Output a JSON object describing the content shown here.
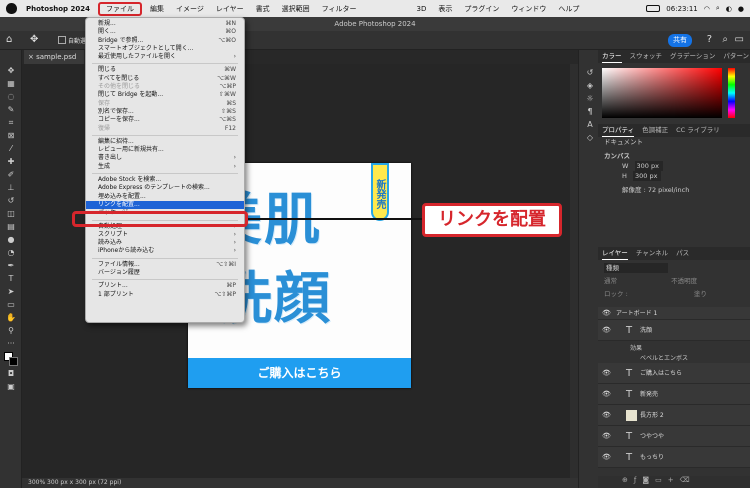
{
  "menubar": {
    "app_name": "Photoshop 2024",
    "items": [
      "ファイル",
      "編集",
      "イメージ",
      "レイヤー",
      "書式",
      "選択範囲",
      "フィルター",
      "3D",
      "表示",
      "プラグイン",
      "ウィンドウ",
      "ヘルプ"
    ],
    "clock": "06:23:11"
  },
  "window_title": "Adobe Photoshop 2024",
  "options": {
    "share_label": "共有",
    "auto_select": "自動選"
  },
  "document_tab": "sample.psd @ 3",
  "file_menu": {
    "g1": [
      {
        "label": "新規...",
        "shortcut": "⌘N"
      },
      {
        "label": "開く...",
        "shortcut": "⌘O"
      },
      {
        "label": "Bridge で参照...",
        "shortcut": "⌥⌘O"
      },
      {
        "label": "スマートオブジェクトとして開く...",
        "shortcut": ""
      },
      {
        "label": "最近使用したファイルを開く",
        "shortcut": "›"
      }
    ],
    "g2": [
      {
        "label": "閉じる",
        "shortcut": "⌘W"
      },
      {
        "label": "すべてを閉じる",
        "shortcut": "⌥⌘W"
      },
      {
        "label": "その他を閉じる",
        "shortcut": "⌥⌘P",
        "disabled": true
      },
      {
        "label": "閉じて Bridge を起動...",
        "shortcut": "⇧⌘W"
      },
      {
        "label": "保存",
        "shortcut": "⌘S",
        "disabled": true
      },
      {
        "label": "別名で保存...",
        "shortcut": "⇧⌘S"
      },
      {
        "label": "コピーを保存...",
        "shortcut": "⌥⌘S"
      },
      {
        "label": "復帰",
        "shortcut": "F12",
        "disabled": true
      }
    ],
    "g3": [
      {
        "label": "編集に招待...",
        "shortcut": ""
      },
      {
        "label": "レビュー用に新規共有...",
        "shortcut": ""
      },
      {
        "label": "書き出し",
        "shortcut": "›"
      },
      {
        "label": "生成",
        "shortcut": "›"
      }
    ],
    "g4": [
      {
        "label": "Adobe Stock を検索...",
        "shortcut": ""
      },
      {
        "label": "Adobe Express のテンプレートの検索...",
        "shortcut": ""
      },
      {
        "label": "埋め込みを配置...",
        "shortcut": ""
      },
      {
        "label": "リンクを配置...",
        "shortcut": "",
        "highlighted": true
      },
      {
        "label": "パッケージ...",
        "shortcut": ""
      }
    ],
    "g5": [
      {
        "label": "自動処理",
        "shortcut": "›"
      },
      {
        "label": "スクリプト",
        "shortcut": "›"
      },
      {
        "label": "読み込み",
        "shortcut": "›"
      },
      {
        "label": "iPhoneから読み込む",
        "shortcut": "›"
      }
    ],
    "g6": [
      {
        "label": "ファイル情報...",
        "shortcut": "⌥⇧⌘I"
      },
      {
        "label": "バージョン履歴",
        "shortcut": ""
      }
    ],
    "g7": [
      {
        "label": "プリント...",
        "shortcut": "⌘P"
      },
      {
        "label": "1 部プリント",
        "shortcut": "⌥⇧⌘P"
      }
    ]
  },
  "callout": "リンクを配置",
  "artwork": {
    "line1": "美肌",
    "line2": "洗顔",
    "badge": "新発売",
    "button": "ご購入はこちら"
  },
  "status": "300%    300 px x 300 px (72 ppi)",
  "panels": {
    "color_tabs": [
      "カラー",
      "スウォッチ",
      "グラデーション",
      "パターン"
    ],
    "prop_tabs": [
      "プロパティ",
      "色調補正",
      "CC ライブラリ"
    ],
    "doc_label": "ドキュメント",
    "canvas_label": "カンバス",
    "w_label": "W",
    "w_value": "300 px",
    "h_label": "H",
    "h_value": "300 px",
    "resolution": "解像度 : 72 pixel/inch",
    "layer_tabs": [
      "レイヤー",
      "チャンネル",
      "パス"
    ],
    "kind": "種類",
    "blend": "通常",
    "opacity": "不透明度",
    "lock": "ロック :",
    "fill": "塗り",
    "artboard": "アートボード 1",
    "layers": [
      "洗顔",
      "ご購入はこちら",
      "新発売",
      "長方形 2",
      "つやつや",
      "もっちり"
    ],
    "effects": "効果",
    "bevel": "ベベルとエンボス"
  }
}
